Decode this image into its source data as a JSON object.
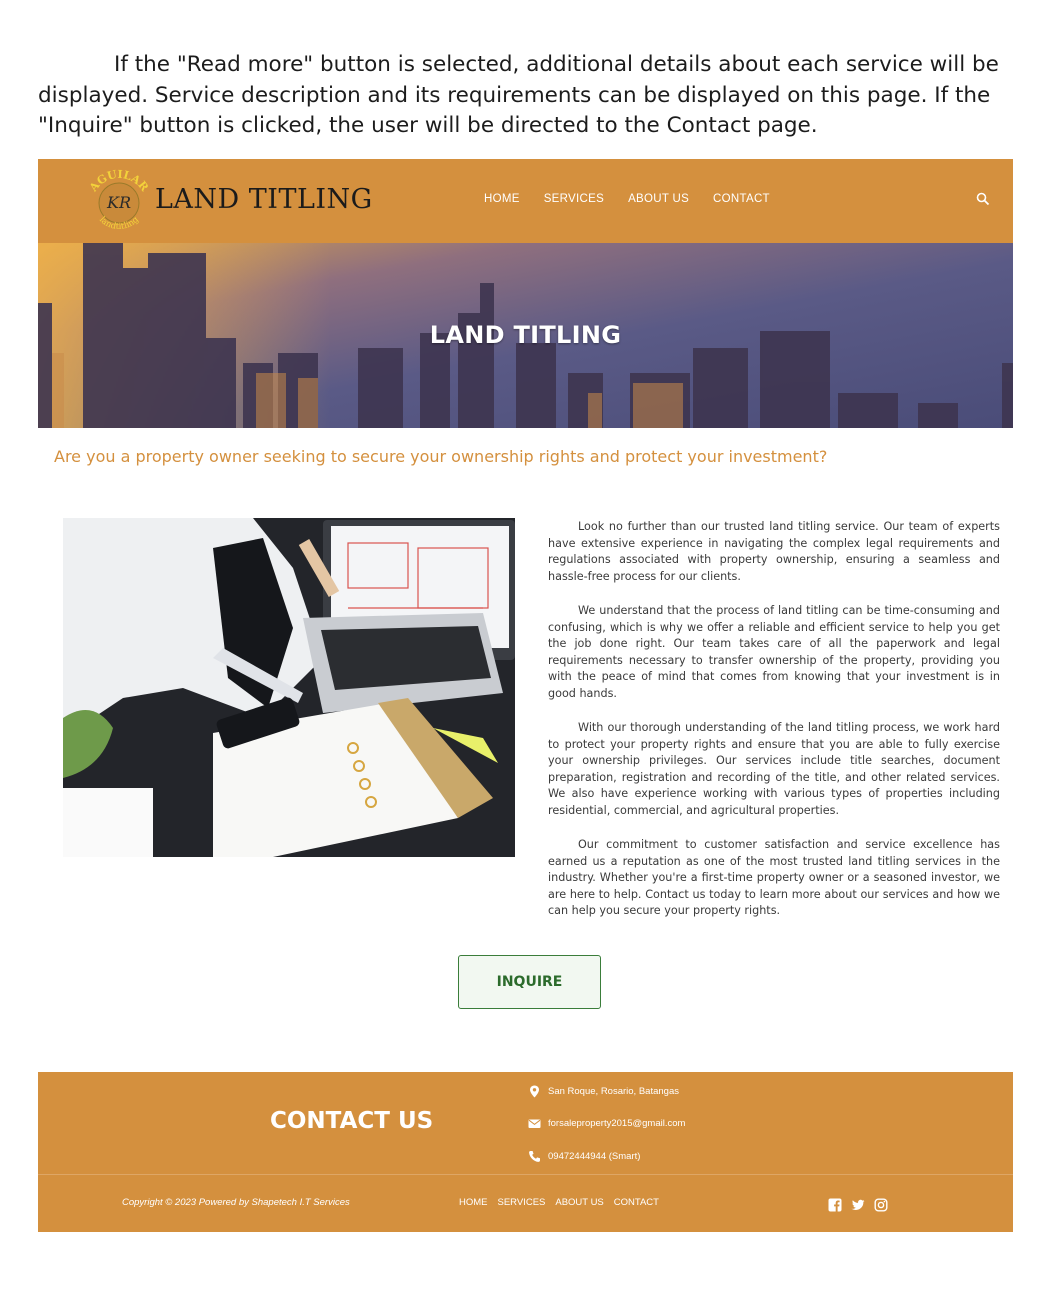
{
  "caption": {
    "text": "If the \"Read more\" button is selected, additional details about each service will be displayed. Service description and its requirements can be displayed on this page. If the \"Inquire\" button is clicked, the user will be directed to the Contact page."
  },
  "header": {
    "logo_top_text": "AGUILAR",
    "logo_monogram": "KR",
    "logo_bottom_text": "landtitling",
    "brand": "LAND TITLING",
    "nav": [
      "HOME",
      "SERVICES",
      "ABOUT US",
      "CONTACT"
    ],
    "search_icon": "search-icon",
    "brand_color": "#d4903e"
  },
  "hero": {
    "title": "LAND TITLING"
  },
  "main": {
    "tagline": "Are you a property owner seeking to secure your ownership rights and protect your investment?",
    "paragraphs": [
      "Look no further than our trusted land titling service. Our team of experts have extensive experience in navigating the complex legal requirements and regulations associated with property ownership, ensuring a seamless and hassle-free process for our clients.",
      "We understand that the process of land titling can be time-consuming and confusing, which is why we offer a reliable and efficient service to help you get the job done right. Our team takes care of all the paperwork and legal requirements necessary to transfer ownership of the property, providing you with the peace of mind that comes from knowing that your investment is in good hands.",
      "With our thorough understanding of the land titling process, we work hard to protect your property rights and ensure that you are able to fully exercise your ownership privileges. Our services include title searches, document preparation, registration and recording of the title, and other related services. We also have experience working with various types of properties including residential, commercial, and agricultural properties.",
      "Our commitment to customer satisfaction and service excellence has earned us a reputation as one of the most trusted land titling services in the industry. Whether you're a first-time property owner or a seasoned investor, we are here to help. Contact us today to learn more about our services and how we can help you secure your property rights."
    ],
    "inquire_label": "INQUIRE"
  },
  "footer": {
    "contact_title": "CONTACT US",
    "address": "San Roque, Rosario, Batangas",
    "email": "forsaleproperty2015@gmail.com",
    "phone": "09472444944 (Smart)",
    "copyright": "Copyright © 2023 Powered by Shapetech I.T Services",
    "nav": [
      "HOME",
      "SERVICES",
      "ABOUT US",
      "CONTACT"
    ],
    "social_icons": [
      "facebook-icon",
      "twitter-icon",
      "instagram-icon"
    ]
  }
}
